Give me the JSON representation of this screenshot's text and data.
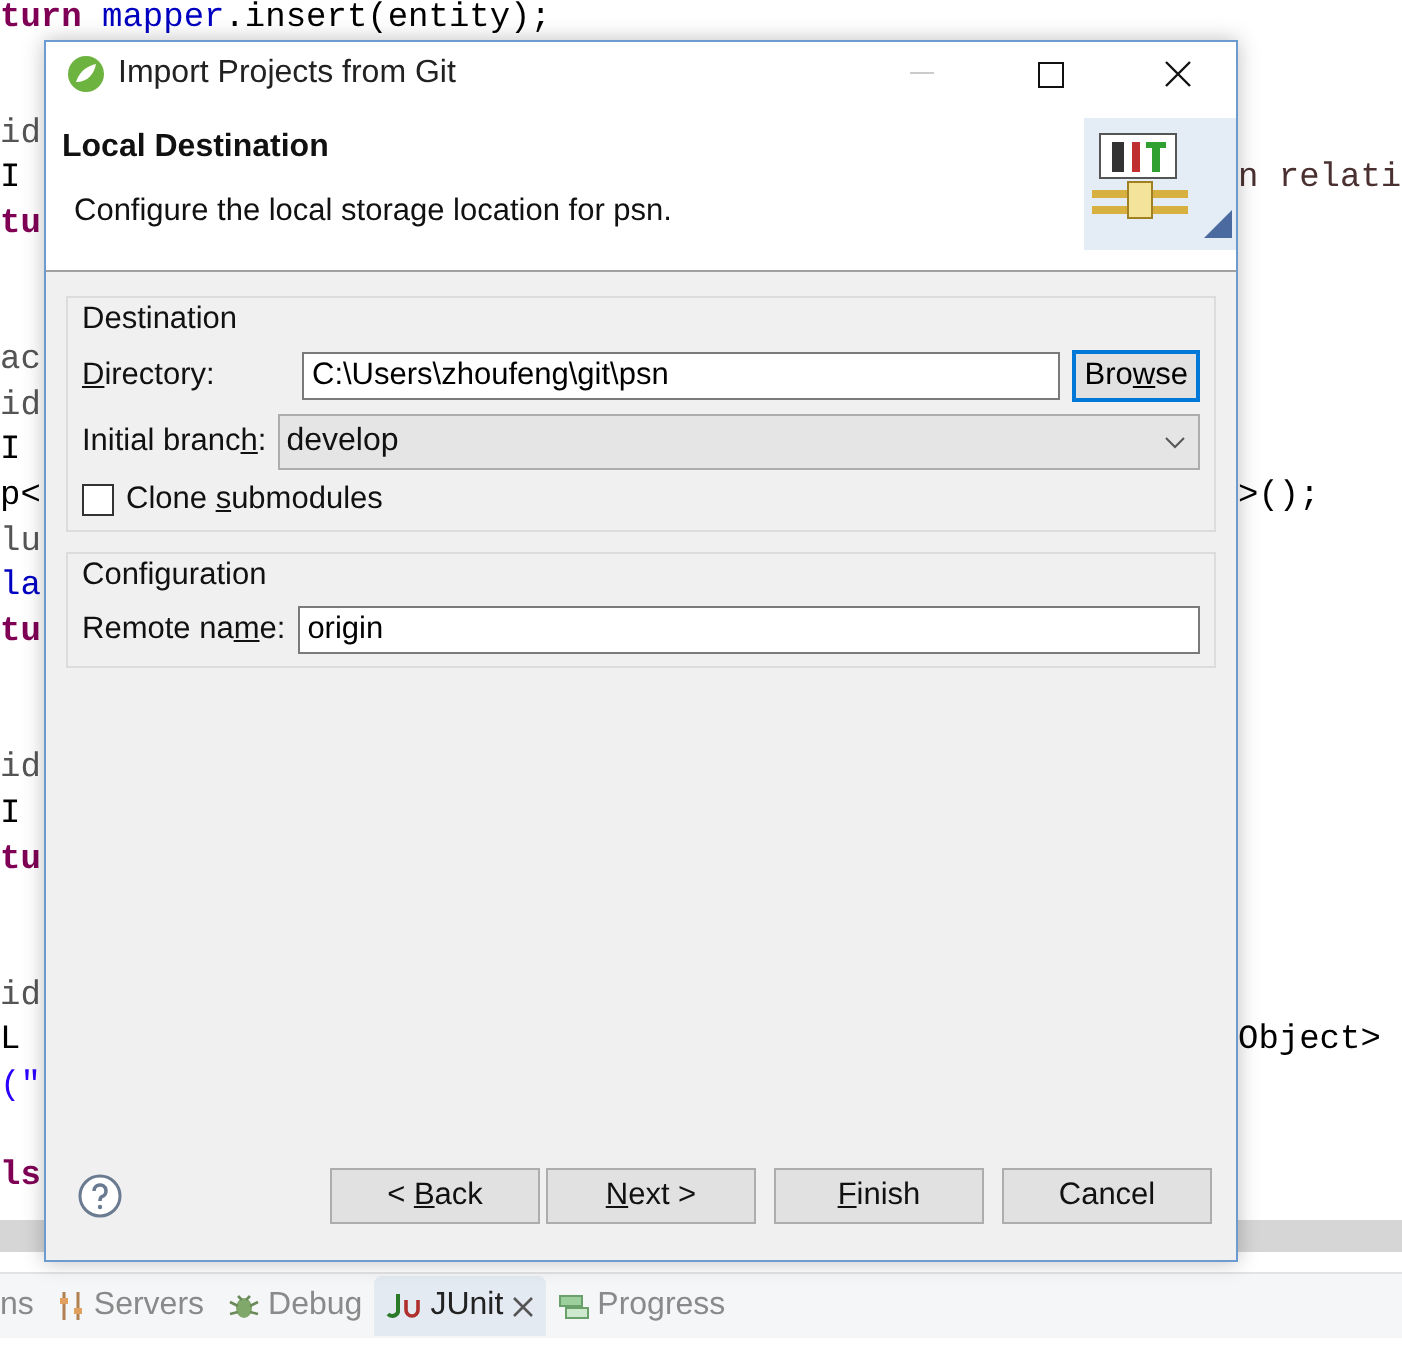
{
  "editor": {
    "top_line": [
      {
        "color": "#7f0055",
        "text": "turn"
      },
      {
        "color": "#0000c0",
        "text": " mapper"
      },
      {
        "color": "#000000",
        "text": ".insert(entity);"
      }
    ],
    "blocks": [
      {
        "lines": [
          {
            "text": "id",
            "color": "#555555"
          },
          {
            "text": "I",
            "color": "#000000",
            "right": {
              "text": "n relati",
              "color": "#4a3030"
            }
          },
          {
            "text": "tu",
            "color": "#7f0055"
          }
        ]
      },
      {
        "lines": [
          {
            "text": "ac",
            "color": "#555555"
          },
          {
            "text": "id",
            "color": "#555555"
          },
          {
            "text": "I",
            "color": "#000000"
          },
          {
            "text": "p<",
            "color": "#000000",
            "right": {
              "text": ">();",
              "color": "#000000"
            }
          },
          {
            "text": "lu",
            "color": "#555555"
          },
          {
            "text": "la",
            "color": "#0000c0"
          },
          {
            "text": "tu",
            "color": "#7f0055"
          }
        ]
      },
      {
        "lines": [
          {
            "text": "id",
            "color": "#555555"
          },
          {
            "text": "I",
            "color": "#000000"
          },
          {
            "text": "tu",
            "color": "#7f0055"
          }
        ]
      },
      {
        "lines": [
          {
            "text": "id",
            "color": "#555555"
          },
          {
            "text": "L",
            "color": "#000000",
            "right": {
              "text": "Object>",
              "color": "#000000"
            }
          },
          {
            "text": "(\"",
            "color": "#2a00ff"
          }
        ]
      },
      {
        "lines": [
          {
            "text": "ls",
            "color": "#7f0055"
          }
        ]
      }
    ]
  },
  "dialog": {
    "title": "Import Projects from Git",
    "header": {
      "title": "Local Destination",
      "description": "Configure the local storage location for psn."
    },
    "destination": {
      "legend": "Destination",
      "directory_label": [
        "D",
        "irectory:"
      ],
      "directory_value": "C:\\Users\\zhoufeng\\git\\psn",
      "browse": [
        "Bro",
        "w",
        "se"
      ],
      "branch_label": [
        "Initial branc",
        "h",
        ":"
      ],
      "branch_value": "develop",
      "clone_label": [
        "Clone ",
        "s",
        "ubmodules"
      ],
      "clone_checked": false
    },
    "configuration": {
      "legend": "Configuration",
      "remote_label": [
        "Remote na",
        "m",
        "e:"
      ],
      "remote_value": "origin"
    },
    "buttons": [
      {
        "label": [
          "< ",
          "B",
          "ack"
        ]
      },
      {
        "label": [
          "N",
          "ext >"
        ]
      },
      {
        "label": [
          "F",
          "inish"
        ]
      },
      {
        "label": [
          "Cancel"
        ]
      }
    ]
  },
  "views": [
    {
      "kind": "cut",
      "label": "ns",
      "selected": false,
      "closable": false
    },
    {
      "kind": "servers",
      "label": "Servers",
      "selected": false,
      "closable": false
    },
    {
      "kind": "debug",
      "label": "Debug",
      "selected": false,
      "closable": false
    },
    {
      "kind": "junit",
      "label": "JUnit",
      "selected": true,
      "closable": true
    },
    {
      "kind": "progress",
      "label": "Progress",
      "selected": false,
      "closable": false
    }
  ]
}
